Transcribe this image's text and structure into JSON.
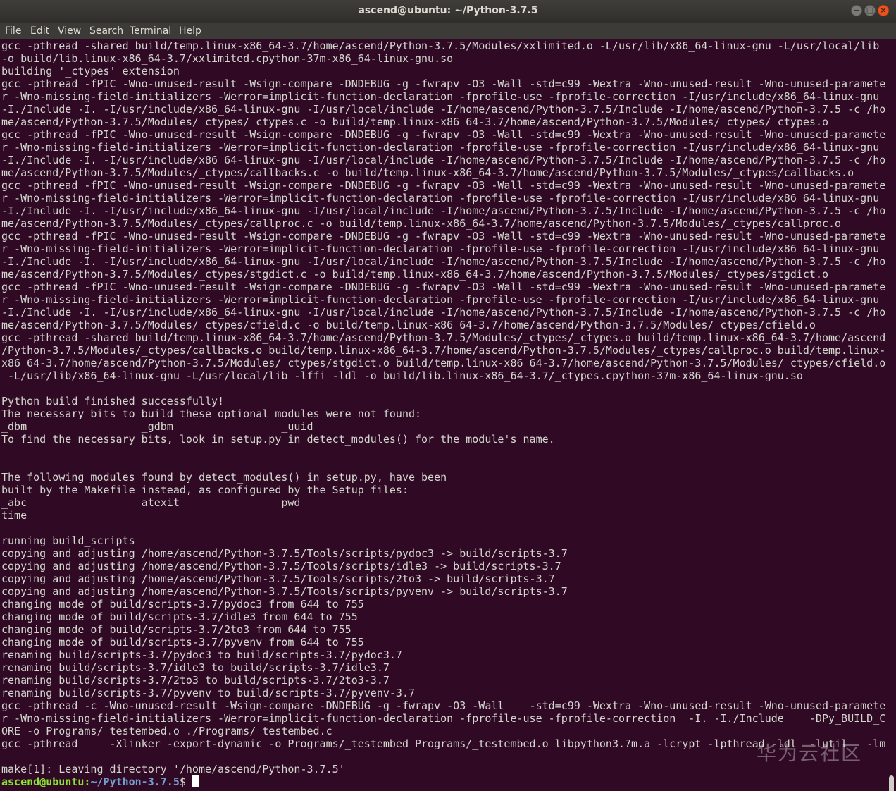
{
  "window": {
    "title": "ascend@ubuntu: ~/Python-3.7.5",
    "controls": {
      "minimize": "−",
      "maximize": "□",
      "close": "×"
    }
  },
  "menu": {
    "file": "File",
    "edit": "Edit",
    "view": "View",
    "search": "Search",
    "terminal": "Terminal",
    "help": "Help"
  },
  "terminal": {
    "lines": [
      "gcc -pthread -shared build/temp.linux-x86_64-3.7/home/ascend/Python-3.7.5/Modules/xxlimited.o -L/usr/lib/x86_64-linux-gnu -L/usr/local/lib",
      "-o build/lib.linux-x86_64-3.7/xxlimited.cpython-37m-x86_64-linux-gnu.so",
      "building '_ctypes' extension",
      "gcc -pthread -fPIC -Wno-unused-result -Wsign-compare -DNDEBUG -g -fwrapv -O3 -Wall -std=c99 -Wextra -Wno-unused-result -Wno-unused-paramete",
      "r -Wno-missing-field-initializers -Werror=implicit-function-declaration -fprofile-use -fprofile-correction -I/usr/include/x86_64-linux-gnu",
      "-I./Include -I. -I/usr/include/x86_64-linux-gnu -I/usr/local/include -I/home/ascend/Python-3.7.5/Include -I/home/ascend/Python-3.7.5 -c /ho",
      "me/ascend/Python-3.7.5/Modules/_ctypes/_ctypes.c -o build/temp.linux-x86_64-3.7/home/ascend/Python-3.7.5/Modules/_ctypes/_ctypes.o",
      "gcc -pthread -fPIC -Wno-unused-result -Wsign-compare -DNDEBUG -g -fwrapv -O3 -Wall -std=c99 -Wextra -Wno-unused-result -Wno-unused-paramete",
      "r -Wno-missing-field-initializers -Werror=implicit-function-declaration -fprofile-use -fprofile-correction -I/usr/include/x86_64-linux-gnu",
      "-I./Include -I. -I/usr/include/x86_64-linux-gnu -I/usr/local/include -I/home/ascend/Python-3.7.5/Include -I/home/ascend/Python-3.7.5 -c /ho",
      "me/ascend/Python-3.7.5/Modules/_ctypes/callbacks.c -o build/temp.linux-x86_64-3.7/home/ascend/Python-3.7.5/Modules/_ctypes/callbacks.o",
      "gcc -pthread -fPIC -Wno-unused-result -Wsign-compare -DNDEBUG -g -fwrapv -O3 -Wall -std=c99 -Wextra -Wno-unused-result -Wno-unused-paramete",
      "r -Wno-missing-field-initializers -Werror=implicit-function-declaration -fprofile-use -fprofile-correction -I/usr/include/x86_64-linux-gnu",
      "-I./Include -I. -I/usr/include/x86_64-linux-gnu -I/usr/local/include -I/home/ascend/Python-3.7.5/Include -I/home/ascend/Python-3.7.5 -c /ho",
      "me/ascend/Python-3.7.5/Modules/_ctypes/callproc.c -o build/temp.linux-x86_64-3.7/home/ascend/Python-3.7.5/Modules/_ctypes/callproc.o",
      "gcc -pthread -fPIC -Wno-unused-result -Wsign-compare -DNDEBUG -g -fwrapv -O3 -Wall -std=c99 -Wextra -Wno-unused-result -Wno-unused-paramete",
      "r -Wno-missing-field-initializers -Werror=implicit-function-declaration -fprofile-use -fprofile-correction -I/usr/include/x86_64-linux-gnu",
      "-I./Include -I. -I/usr/include/x86_64-linux-gnu -I/usr/local/include -I/home/ascend/Python-3.7.5/Include -I/home/ascend/Python-3.7.5 -c /ho",
      "me/ascend/Python-3.7.5/Modules/_ctypes/stgdict.c -o build/temp.linux-x86_64-3.7/home/ascend/Python-3.7.5/Modules/_ctypes/stgdict.o",
      "gcc -pthread -fPIC -Wno-unused-result -Wsign-compare -DNDEBUG -g -fwrapv -O3 -Wall -std=c99 -Wextra -Wno-unused-result -Wno-unused-paramete",
      "r -Wno-missing-field-initializers -Werror=implicit-function-declaration -fprofile-use -fprofile-correction -I/usr/include/x86_64-linux-gnu",
      "-I./Include -I. -I/usr/include/x86_64-linux-gnu -I/usr/local/include -I/home/ascend/Python-3.7.5/Include -I/home/ascend/Python-3.7.5 -c /ho",
      "me/ascend/Python-3.7.5/Modules/_ctypes/cfield.c -o build/temp.linux-x86_64-3.7/home/ascend/Python-3.7.5/Modules/_ctypes/cfield.o",
      "gcc -pthread -shared build/temp.linux-x86_64-3.7/home/ascend/Python-3.7.5/Modules/_ctypes/_ctypes.o build/temp.linux-x86_64-3.7/home/ascend",
      "/Python-3.7.5/Modules/_ctypes/callbacks.o build/temp.linux-x86_64-3.7/home/ascend/Python-3.7.5/Modules/_ctypes/callproc.o build/temp.linux-",
      "x86_64-3.7/home/ascend/Python-3.7.5/Modules/_ctypes/stgdict.o build/temp.linux-x86_64-3.7/home/ascend/Python-3.7.5/Modules/_ctypes/cfield.o",
      " -L/usr/lib/x86_64-linux-gnu -L/usr/local/lib -lffi -ldl -o build/lib.linux-x86_64-3.7/_ctypes.cpython-37m-x86_64-linux-gnu.so",
      "",
      "Python build finished successfully!",
      "The necessary bits to build these optional modules were not found:",
      "_dbm                  _gdbm                 _uuid",
      "To find the necessary bits, look in setup.py in detect_modules() for the module's name.",
      "",
      "",
      "The following modules found by detect_modules() in setup.py, have been",
      "built by the Makefile instead, as configured by the Setup files:",
      "_abc                  atexit                pwd",
      "time",
      "",
      "running build_scripts",
      "copying and adjusting /home/ascend/Python-3.7.5/Tools/scripts/pydoc3 -> build/scripts-3.7",
      "copying and adjusting /home/ascend/Python-3.7.5/Tools/scripts/idle3 -> build/scripts-3.7",
      "copying and adjusting /home/ascend/Python-3.7.5/Tools/scripts/2to3 -> build/scripts-3.7",
      "copying and adjusting /home/ascend/Python-3.7.5/Tools/scripts/pyvenv -> build/scripts-3.7",
      "changing mode of build/scripts-3.7/pydoc3 from 644 to 755",
      "changing mode of build/scripts-3.7/idle3 from 644 to 755",
      "changing mode of build/scripts-3.7/2to3 from 644 to 755",
      "changing mode of build/scripts-3.7/pyvenv from 644 to 755",
      "renaming build/scripts-3.7/pydoc3 to build/scripts-3.7/pydoc3.7",
      "renaming build/scripts-3.7/idle3 to build/scripts-3.7/idle3.7",
      "renaming build/scripts-3.7/2to3 to build/scripts-3.7/2to3-3.7",
      "renaming build/scripts-3.7/pyvenv to build/scripts-3.7/pyvenv-3.7",
      "gcc -pthread -c -Wno-unused-result -Wsign-compare -DNDEBUG -g -fwrapv -O3 -Wall    -std=c99 -Wextra -Wno-unused-result -Wno-unused-paramete",
      "r -Wno-missing-field-initializers -Werror=implicit-function-declaration -fprofile-use -fprofile-correction  -I. -I./Include    -DPy_BUILD_C",
      "ORE -o Programs/_testembed.o ./Programs/_testembed.c",
      "gcc -pthread     -Xlinker -export-dynamic -o Programs/_testembed Programs/_testembed.o libpython3.7m.a -lcrypt -lpthread -ldl  -lutil   -lm",
      "",
      "make[1]: Leaving directory '/home/ascend/Python-3.7.5'"
    ],
    "prompt": {
      "user_host": "ascend@ubuntu",
      "separator": ":",
      "path": "~/Python-3.7.5",
      "symbol": "$ "
    }
  },
  "watermark": "华为云社区",
  "colors": {
    "terminal_bg": "#300a24",
    "terminal_fg": "#d3d7cf",
    "prompt_user": "#8ae234",
    "prompt_path": "#729fcf",
    "titlebar_bg": "#3f3e3a",
    "menubar_bg": "#3c3b37",
    "close_button": "#e9541f"
  }
}
